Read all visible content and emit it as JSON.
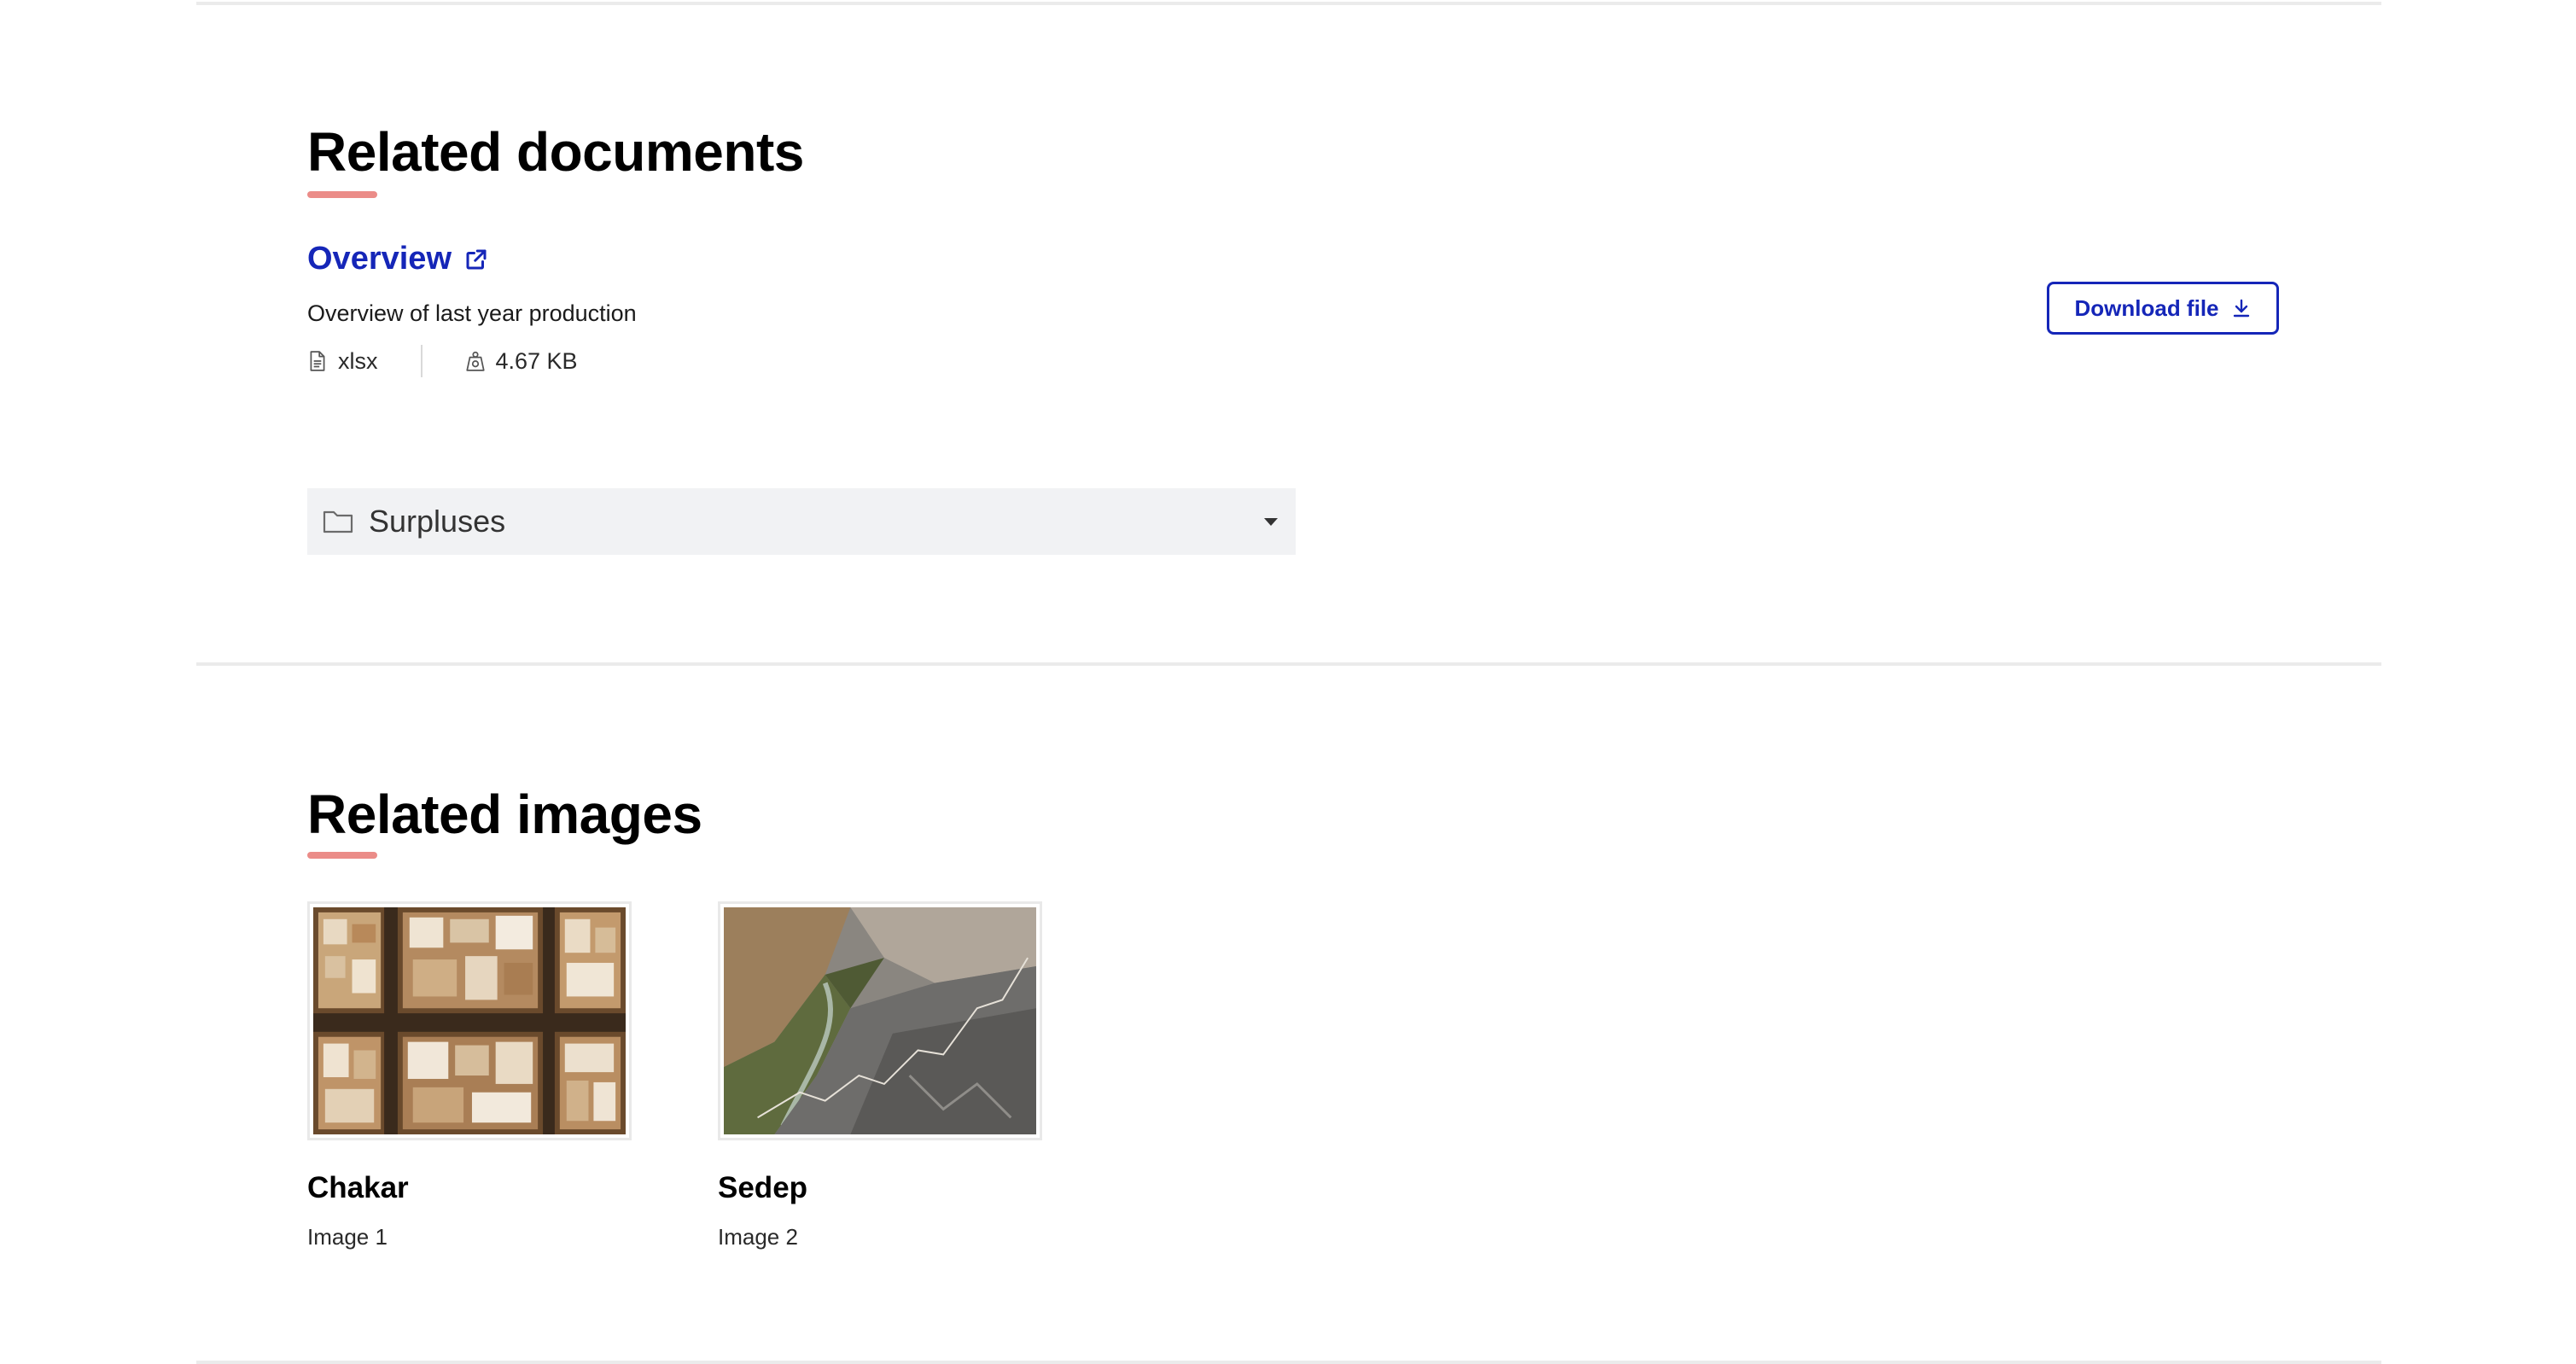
{
  "documents_section": {
    "title": "Related documents",
    "document": {
      "title": "Overview",
      "description": "Overview of last year production",
      "file_type": "xlsx",
      "file_size": "4.67 KB",
      "download_label": "Download file"
    },
    "accordion": {
      "label": "Surpluses"
    }
  },
  "images_section": {
    "title": "Related images",
    "images": [
      {
        "title": "Chakar",
        "caption": "Image 1"
      },
      {
        "title": "Sedep",
        "caption": "Image 2"
      }
    ]
  },
  "colors": {
    "link": "#1526b8",
    "accent_underline": "#eb8c88",
    "accordion_bg": "#f1f2f4",
    "divider": "#ebebeb"
  },
  "icons": {
    "external_link": "external-link-icon",
    "file": "file-icon",
    "weight": "weight-icon",
    "download": "download-icon",
    "folder": "folder-icon",
    "caret": "caret-down-icon"
  }
}
